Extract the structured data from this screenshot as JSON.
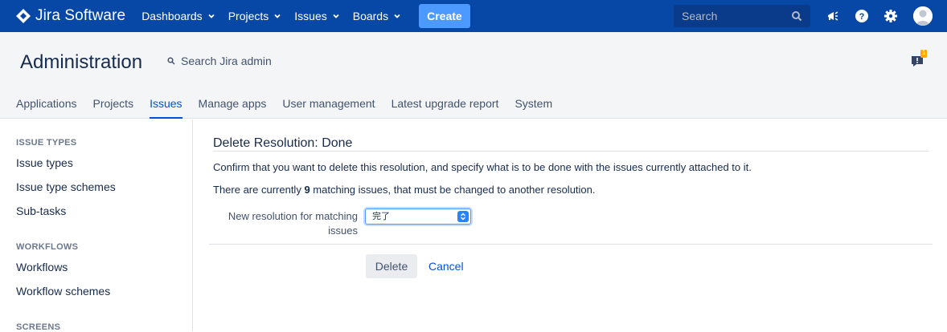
{
  "topnav": {
    "brand": "Jira Software",
    "menus": [
      "Dashboards",
      "Projects",
      "Issues",
      "Boards"
    ],
    "create_label": "Create",
    "search_placeholder": "Search",
    "colors": {
      "bar": "#0747a6",
      "create": "#4c9aff"
    }
  },
  "admin": {
    "title": "Administration",
    "search_label": "Search Jira admin",
    "feedback_badge": "1",
    "tabs": [
      "Applications",
      "Projects",
      "Issues",
      "Manage apps",
      "User management",
      "Latest upgrade report",
      "System"
    ],
    "active_tab": "Issues"
  },
  "sidebar": {
    "sections": [
      {
        "heading": "ISSUE TYPES",
        "items": [
          "Issue types",
          "Issue type schemes",
          "Sub-tasks"
        ]
      },
      {
        "heading": "WORKFLOWS",
        "items": [
          "Workflows",
          "Workflow schemes"
        ]
      },
      {
        "heading": "SCREENS",
        "items": []
      }
    ]
  },
  "main": {
    "heading": "Delete Resolution: Done",
    "confirm_text": "Confirm that you want to delete this resolution, and specify what is to be done with the issues currently attached to it.",
    "count_prefix": "There are currently ",
    "count": "9",
    "count_suffix": " matching issues, that must be changed to another resolution.",
    "field_label": "New resolution for matching issues",
    "select_value": "完了",
    "delete_label": "Delete",
    "cancel_label": "Cancel"
  }
}
